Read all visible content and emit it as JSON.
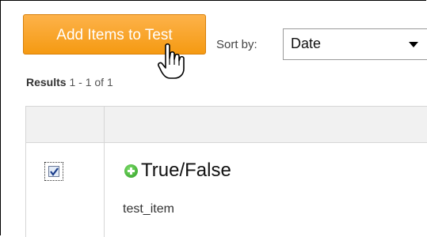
{
  "toolbar": {
    "add_button_label": "Add Items to Test",
    "sort_label": "Sort by:",
    "sort_value": "Date"
  },
  "results": {
    "prefix": "Results",
    "range": "1 - 1 of 1"
  },
  "items": [
    {
      "type": "True/False",
      "name": "test_item",
      "checked": true
    }
  ],
  "colors": {
    "button": "#f7a11f",
    "plus": "#3cae2e"
  },
  "icons": {
    "cursor": "hand-pointer-icon",
    "add": "plus-circle-icon",
    "checkbox": "checkbox-checked-icon"
  }
}
